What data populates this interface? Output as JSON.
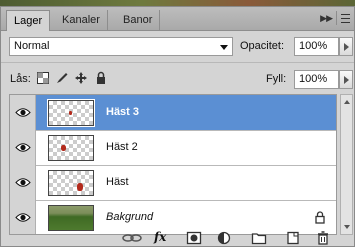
{
  "tabs": [
    {
      "label": "Lager",
      "active": true
    },
    {
      "label": "Kanaler",
      "active": false
    },
    {
      "label": "Banor",
      "active": false
    }
  ],
  "blend": {
    "mode": "Normal"
  },
  "opacity": {
    "label": "Opacitet:",
    "value": "100%"
  },
  "lock": {
    "label": "Lås:",
    "icons": [
      "lock-transparent-icon",
      "lock-image-icon",
      "lock-position-icon",
      "lock-all-icon"
    ]
  },
  "fill": {
    "label": "Fyll:",
    "value": "100%"
  },
  "layers": [
    {
      "name": "Häst 3",
      "selected": true,
      "visible": true
    },
    {
      "name": "Häst 2",
      "selected": false,
      "visible": true
    },
    {
      "name": "Häst",
      "selected": false,
      "visible": true
    },
    {
      "name": "Bakgrund",
      "selected": false,
      "visible": true,
      "locked": true
    }
  ],
  "toolbar": {
    "fx_label": "fx"
  },
  "colors": {
    "selection": "#5b8fd3",
    "panel": "#d4d4d4"
  }
}
